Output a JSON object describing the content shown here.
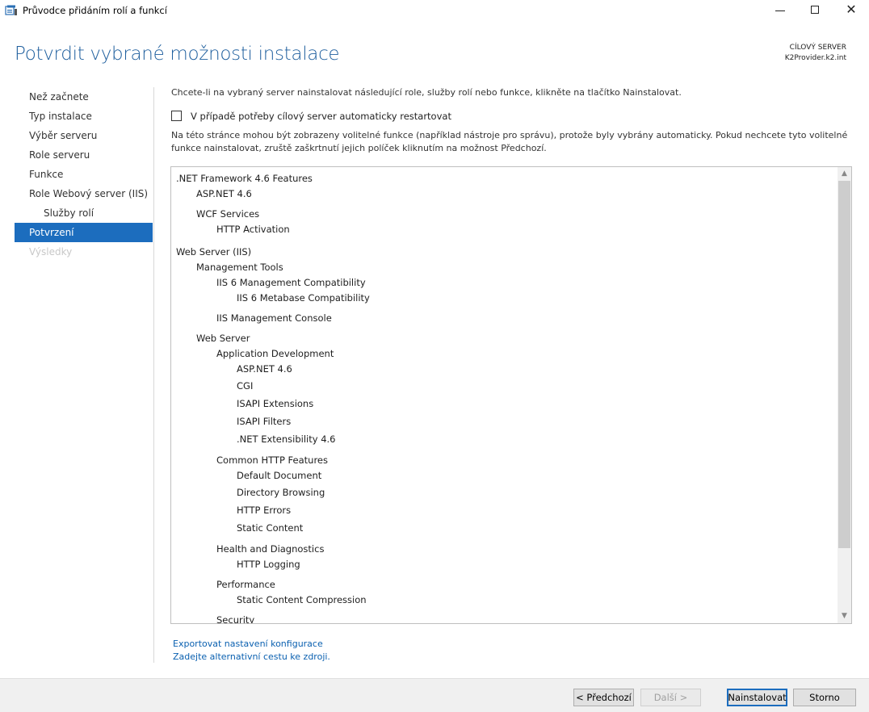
{
  "window": {
    "title": "Průvodce přidáním rolí a funkcí",
    "minimize_glyph": "",
    "maximize_glyph": "",
    "close_glyph": "✕"
  },
  "header": {
    "page_title": "Potvrdit vybrané možnosti instalace",
    "target_server_label": "CÍLOVÝ SERVER",
    "target_server_name": "K2Provider.k2.int"
  },
  "nav": {
    "items": [
      {
        "label": "Než začnete",
        "state": "normal"
      },
      {
        "label": "Typ instalace",
        "state": "normal"
      },
      {
        "label": "Výběr serveru",
        "state": "normal"
      },
      {
        "label": "Role serveru",
        "state": "normal"
      },
      {
        "label": "Funkce",
        "state": "normal"
      },
      {
        "label": "Role Webový server (IIS)",
        "state": "normal"
      },
      {
        "label": "Služby rolí",
        "state": "sub"
      },
      {
        "label": "Potvrzení",
        "state": "active"
      },
      {
        "label": "Výsledky",
        "state": "disabled"
      }
    ]
  },
  "main": {
    "intro": "Chcete-li na vybraný server nainstalovat následující role, služby rolí nebo funkce, klikněte na tlačítko Nainstalovat.",
    "restart_checkbox": {
      "label": "V případě potřeby cílový server automaticky restartovat",
      "checked": false
    },
    "note": "Na této stránce mohou být zobrazeny volitelné funkce (například nástroje pro správu), protože byly vybrány automaticky. Pokud nechcete tyto volitelné funkce nainstalovat, zruště zaškrtnutí jejich políček kliknutím na možnost Předchozí.",
    "features": [
      {
        "label": ".NET Framework 4.6 Features",
        "level": 0
      },
      {
        "label": "ASP.NET 4.6",
        "level": 1
      },
      {
        "label": "WCF Services",
        "level": 1
      },
      {
        "label": "HTTP Activation",
        "level": 2
      },
      {
        "label": "Web Server (IIS)",
        "level": 0
      },
      {
        "label": "Management Tools",
        "level": 1
      },
      {
        "label": "IIS 6 Management Compatibility",
        "level": 2
      },
      {
        "label": "IIS 6 Metabase Compatibility",
        "level": 3
      },
      {
        "label": "IIS Management Console",
        "level": 2
      },
      {
        "label": "Web Server",
        "level": 1
      },
      {
        "label": "Application Development",
        "level": 2
      },
      {
        "label": "ASP.NET 4.6",
        "level": 3
      },
      {
        "label": "CGI",
        "level": 3
      },
      {
        "label": "ISAPI Extensions",
        "level": 3
      },
      {
        "label": "ISAPI Filters",
        "level": 3
      },
      {
        "label": ".NET Extensibility 4.6",
        "level": 3
      },
      {
        "label": "Common HTTP Features",
        "level": 2
      },
      {
        "label": "Default Document",
        "level": 3
      },
      {
        "label": "Directory Browsing",
        "level": 3
      },
      {
        "label": "HTTP Errors",
        "level": 3
      },
      {
        "label": "Static Content",
        "level": 3
      },
      {
        "label": "Health and Diagnostics",
        "level": 2
      },
      {
        "label": "HTTP Logging",
        "level": 3
      },
      {
        "label": "Performance",
        "level": 2
      },
      {
        "label": "Static Content Compression",
        "level": 3
      },
      {
        "label": "Security",
        "level": 2
      }
    ],
    "export_link": "Exportovat nastavení konfigurace",
    "alt_source_link": "Zadejte alternativní cestu ke zdroji."
  },
  "footer": {
    "prev_label": "< Předchozí",
    "next_label": "Další >",
    "install_label": "Nainstalovat",
    "cancel_label": "Storno"
  },
  "colors": {
    "accent": "#1c6dbe",
    "title": "#1f5f9e",
    "link": "#0a60b0"
  }
}
